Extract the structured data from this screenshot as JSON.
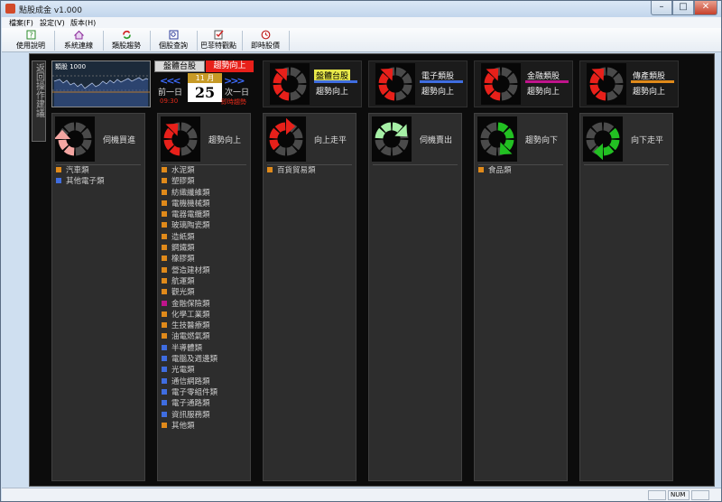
{
  "window": {
    "title": "點股成金 v1.000"
  },
  "menu": [
    "檔案(F)",
    "設定(V)",
    "版本(H)"
  ],
  "toolbar": [
    {
      "label": "使用說明",
      "icon": "help-icon"
    },
    {
      "label": "系統連線",
      "icon": "home-connect-icon"
    },
    {
      "label": "類股趨勢",
      "icon": "refresh-trend-icon"
    },
    {
      "label": "個股查詢",
      "icon": "stock-search-icon"
    },
    {
      "label": "巴菲特觀點",
      "icon": "checklist-icon"
    },
    {
      "label": "即時股價",
      "icon": "clock-icon"
    }
  ],
  "side_tab": "返回操作建議",
  "mini_chart": {
    "label": "類股 1000"
  },
  "date_box": {
    "tab_market": "盤體台股",
    "tab_trend": "趨勢向上",
    "month": "11 月",
    "day": "25",
    "prev_label": "前一日",
    "next_label": "次一日",
    "prev_sub": "09:30",
    "next_sub": "即時趨勢"
  },
  "indices": [
    {
      "name": "盤體台股",
      "trend": "趨勢向上",
      "highlight": true,
      "bar_color": "#3f6de0"
    },
    {
      "name": "電子類股",
      "trend": "趨勢向上",
      "highlight": false,
      "bar_color": "#3f6de0"
    },
    {
      "name": "金融類股",
      "trend": "趨勢向上",
      "highlight": false,
      "bar_color": "#c0148c"
    },
    {
      "name": "傳產類股",
      "trend": "趨勢向上",
      "highlight": false,
      "bar_color": "#e08a1a"
    }
  ],
  "columns": [
    {
      "label": "伺機買進",
      "items": [
        {
          "text": "汽車類",
          "color": "#e08a1a"
        },
        {
          "text": "其他電子類",
          "color": "#3f6de0"
        }
      ]
    },
    {
      "label": "趨勢向上",
      "items": [
        {
          "text": "水泥類",
          "color": "#e08a1a"
        },
        {
          "text": "塑膠類",
          "color": "#e08a1a"
        },
        {
          "text": "紡織纖維類",
          "color": "#e08a1a"
        },
        {
          "text": "電機機械類",
          "color": "#e08a1a"
        },
        {
          "text": "電器電纜類",
          "color": "#e08a1a"
        },
        {
          "text": "玻璃陶瓷類",
          "color": "#e08a1a"
        },
        {
          "text": "造紙類",
          "color": "#e08a1a"
        },
        {
          "text": "鋼鐵類",
          "color": "#e08a1a"
        },
        {
          "text": "橡膠類",
          "color": "#e08a1a"
        },
        {
          "text": "營造建材類",
          "color": "#e08a1a"
        },
        {
          "text": "航運類",
          "color": "#e08a1a"
        },
        {
          "text": "觀光類",
          "color": "#e08a1a"
        },
        {
          "text": "金融保險類",
          "color": "#c0148c"
        },
        {
          "text": "化學工業類",
          "color": "#e08a1a"
        },
        {
          "text": "生技醫療類",
          "color": "#e08a1a"
        },
        {
          "text": "油電燃氣類",
          "color": "#e08a1a"
        },
        {
          "text": "半導體類",
          "color": "#3f6de0"
        },
        {
          "text": "電腦及週邊類",
          "color": "#3f6de0"
        },
        {
          "text": "光電類",
          "color": "#3f6de0"
        },
        {
          "text": "通信網路類",
          "color": "#3f6de0"
        },
        {
          "text": "電子零組件類",
          "color": "#3f6de0"
        },
        {
          "text": "電子通路類",
          "color": "#3f6de0"
        },
        {
          "text": "資訊服務類",
          "color": "#3f6de0"
        },
        {
          "text": "其他類",
          "color": "#e08a1a"
        }
      ]
    },
    {
      "label": "向上走平",
      "items": [
        {
          "text": "百貨貿易類",
          "color": "#e08a1a"
        }
      ]
    },
    {
      "label": "伺機賣出",
      "items": []
    },
    {
      "label": "趨勢向下",
      "items": [
        {
          "text": "食品類",
          "color": "#e08a1a"
        }
      ]
    },
    {
      "label": "向下走平",
      "items": []
    }
  ],
  "status": {
    "num": "NUM"
  }
}
